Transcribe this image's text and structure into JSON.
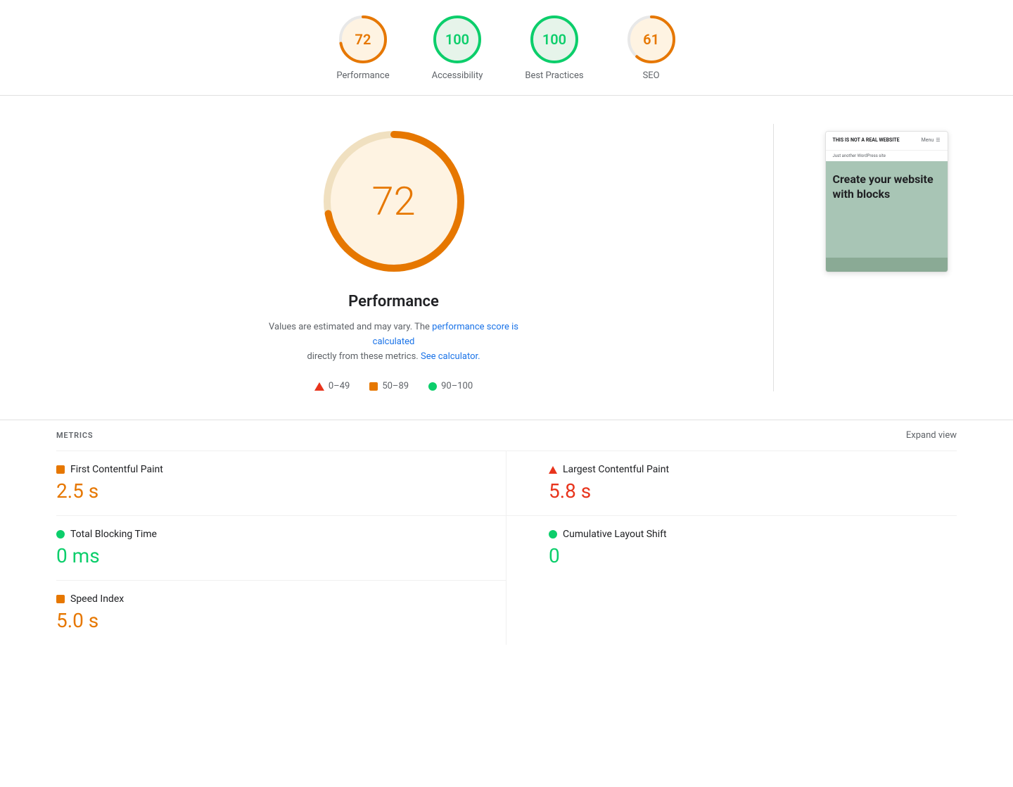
{
  "scores": {
    "performance": {
      "value": 72,
      "label": "Performance",
      "color": "#e67700",
      "ring_color": "#e67700",
      "bg_color": "#fef3e2",
      "circumference": 201,
      "dasharray": "145 56"
    },
    "accessibility": {
      "value": 100,
      "label": "Accessibility",
      "color": "#0cce6b",
      "ring_color": "#0cce6b",
      "bg_color": "#e6f4ea",
      "circumference": 201,
      "dasharray": "201 0"
    },
    "best_practices": {
      "value": 100,
      "label": "Best Practices",
      "color": "#0cce6b",
      "ring_color": "#0cce6b",
      "bg_color": "#e6f4ea",
      "circumference": 201,
      "dasharray": "201 0"
    },
    "seo": {
      "value": 61,
      "label": "SEO",
      "color": "#e67700",
      "ring_color": "#e67700",
      "bg_color": "#fef3e2",
      "circumference": 201,
      "dasharray": "123 78"
    }
  },
  "main": {
    "gauge_score": "72",
    "title": "Performance",
    "desc_text": "Values are estimated and may vary. The",
    "link1_text": "performance score is calculated",
    "desc_text2": "directly from these metrics.",
    "link2_text": "See calculator.",
    "legend": {
      "range1": "0–49",
      "range2": "50–89",
      "range3": "90–100"
    }
  },
  "screenshot": {
    "site_title": "THIS IS NOT A REAL\nWEBSITE",
    "menu_label": "Menu",
    "subtitle": "Just another WordPress\nsite",
    "hero_text": "Create\nyour\nwebsite\nwith\nblocks"
  },
  "metrics": {
    "title": "METRICS",
    "expand_label": "Expand view",
    "items": [
      {
        "label": "First Contentful Paint",
        "value": "2.5 s",
        "color_class": "orange",
        "icon_type": "square"
      },
      {
        "label": "Largest Contentful Paint",
        "value": "5.8 s",
        "color_class": "red",
        "icon_type": "triangle"
      },
      {
        "label": "Total Blocking Time",
        "value": "0 ms",
        "color_class": "green",
        "icon_type": "circle"
      },
      {
        "label": "Cumulative Layout Shift",
        "value": "0",
        "color_class": "green",
        "icon_type": "circle"
      },
      {
        "label": "Speed Index",
        "value": "5.0 s",
        "color_class": "orange",
        "icon_type": "square"
      }
    ]
  }
}
